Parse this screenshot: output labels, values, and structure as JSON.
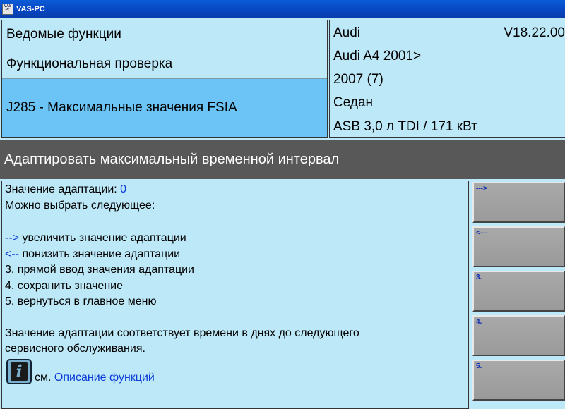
{
  "window": {
    "title": "VAS-PC",
    "icon_text": "VAS PC"
  },
  "nav": {
    "guided_functions": "Ведомые функции",
    "functional_test": "Функциональная проверка",
    "selected_test": "J285 - Максимальные значения FSIA"
  },
  "vehicle": {
    "brand": "Audi",
    "version": "V18.22.00",
    "model": "Audi A4 2001>",
    "year": "2007 (7)",
    "body": "Седан",
    "engine": "ASB 3,0 л TDI / 171 кВт"
  },
  "function_title": "Адаптировать максимальный временной интервал",
  "content": {
    "adaptation_label": "Значение адаптации: ",
    "adaptation_value": "0",
    "options_intro": " Можно выбрать следующее:",
    "opt1_key": "-->",
    "opt1_text": " увеличить значение адаптации",
    "opt2_key": " <--",
    "opt2_text": " понизить значение адаптации",
    "opt3": " 3. прямой ввод значения адаптации",
    "opt4": " 4. сохранить значение",
    "opt5": " 5. вернуться в главное меню",
    "note_line1": "Значение адаптации соответствует времени в днях до следующего",
    "note_line2": "сервисного обслуживания.",
    "see_label": "см.",
    "see_link": "Описание функций"
  },
  "side_buttons": [
    {
      "label": "--->"
    },
    {
      "label": "<---"
    },
    {
      "label": "3."
    },
    {
      "label": "4."
    },
    {
      "label": "5."
    }
  ],
  "icons": {
    "info": "info-icon",
    "app": "vas-pc-icon"
  }
}
